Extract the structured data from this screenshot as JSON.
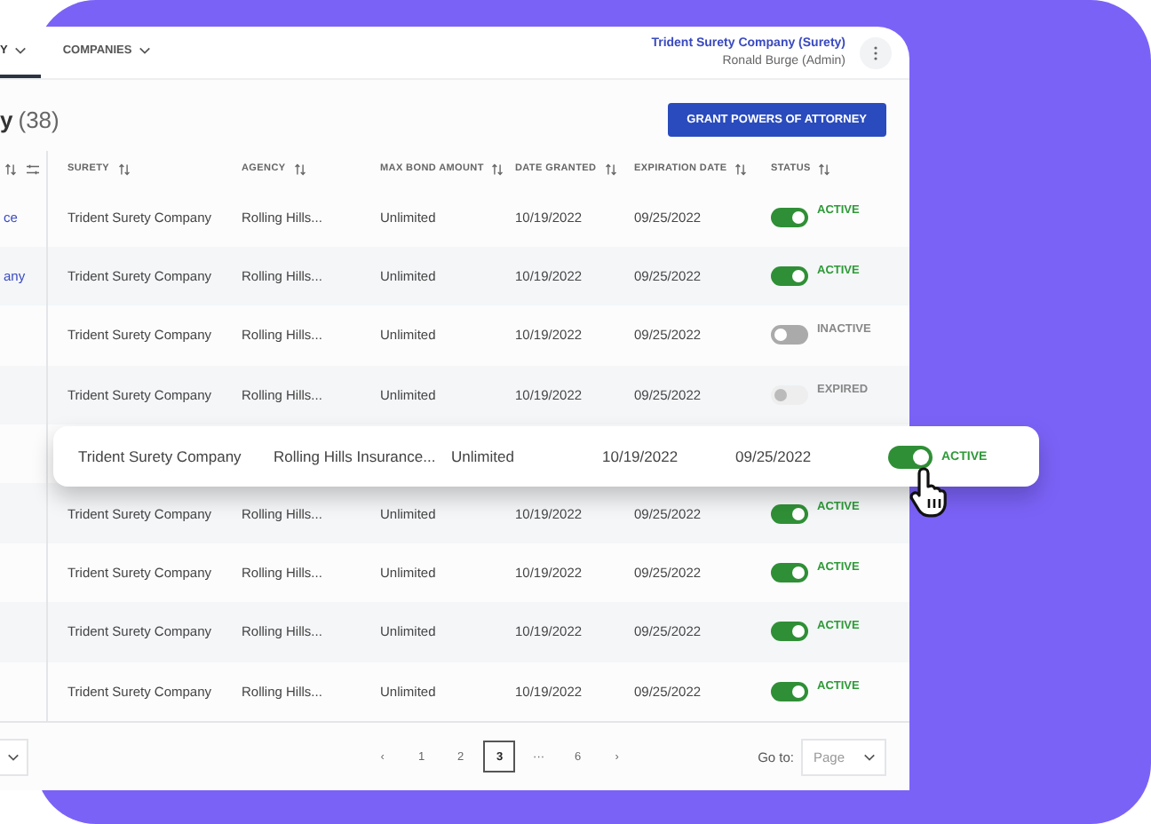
{
  "nav": {
    "tabs": [
      {
        "label": "Y",
        "selected": true
      },
      {
        "label": "COMPANIES",
        "selected": false
      }
    ],
    "account": {
      "company": "Trident Surety Company (Surety)",
      "user": "Ronald Burge (Admin)"
    }
  },
  "page": {
    "title": "y",
    "count": "(38)",
    "action": "GRANT POWERS OF ATTORNEY"
  },
  "side_column": {
    "cells": [
      "ce",
      "any"
    ]
  },
  "table": {
    "columns": [
      "SURETY",
      "AGENCY",
      "MAX BOND AMOUNT",
      "DATE GRANTED",
      "EXPIRATION DATE",
      "STATUS"
    ],
    "rows_above": [
      {
        "surety": "Trident Surety Company",
        "agency": "Rolling Hills...",
        "max_bond": "Unlimited",
        "granted": "10/19/2022",
        "expiration": "09/25/2022",
        "on": true,
        "disabled": false,
        "status": "ACTIVE"
      },
      {
        "surety": "Trident Surety Company",
        "agency": "Rolling Hills...",
        "max_bond": "Unlimited",
        "granted": "10/19/2022",
        "expiration": "09/25/2022",
        "on": true,
        "disabled": false,
        "status": "ACTIVE"
      },
      {
        "surety": "Trident Surety Company",
        "agency": "Rolling Hills...",
        "max_bond": "Unlimited",
        "granted": "10/19/2022",
        "expiration": "09/25/2022",
        "on": false,
        "disabled": false,
        "status": "INACTIVE"
      },
      {
        "surety": "Trident Surety Company",
        "agency": "Rolling Hills...",
        "max_bond": "Unlimited",
        "granted": "10/19/2022",
        "expiration": "09/25/2022",
        "on": false,
        "disabled": true,
        "status": "EXPIRED"
      }
    ],
    "floating_row": {
      "surety": "Trident Surety Company",
      "agency": "Rolling Hills Insurance...",
      "max_bond": "Unlimited",
      "granted": "10/19/2022",
      "expiration": "09/25/2022",
      "on": true,
      "disabled": false,
      "status": "ACTIVE"
    },
    "rows_below": [
      {
        "surety": "Trident Surety Company",
        "agency": "Rolling Hills...",
        "max_bond": "Unlimited",
        "granted": "10/19/2022",
        "expiration": "09/25/2022",
        "on": true,
        "disabled": false,
        "status": "ACTIVE"
      },
      {
        "surety": "Trident Surety Company",
        "agency": "Rolling Hills...",
        "max_bond": "Unlimited",
        "granted": "10/19/2022",
        "expiration": "09/25/2022",
        "on": true,
        "disabled": false,
        "status": "ACTIVE"
      },
      {
        "surety": "Trident Surety Company",
        "agency": "Rolling Hills...",
        "max_bond": "Unlimited",
        "granted": "10/19/2022",
        "expiration": "09/25/2022",
        "on": true,
        "disabled": false,
        "status": "ACTIVE"
      },
      {
        "surety": "Trident Surety Company",
        "agency": "Rolling Hills...",
        "max_bond": "Unlimited",
        "granted": "10/19/2022",
        "expiration": "09/25/2022",
        "on": true,
        "disabled": false,
        "status": "ACTIVE"
      }
    ]
  },
  "pagination": {
    "prev": "‹",
    "pages": [
      {
        "label": "1",
        "selected": false
      },
      {
        "label": "2",
        "selected": false
      },
      {
        "label": "3",
        "selected": true
      },
      {
        "label": "···",
        "selected": false
      },
      {
        "label": "6",
        "selected": false
      }
    ],
    "next": "›",
    "goto_label": "Go to:",
    "goto_placeholder": "Page"
  }
}
